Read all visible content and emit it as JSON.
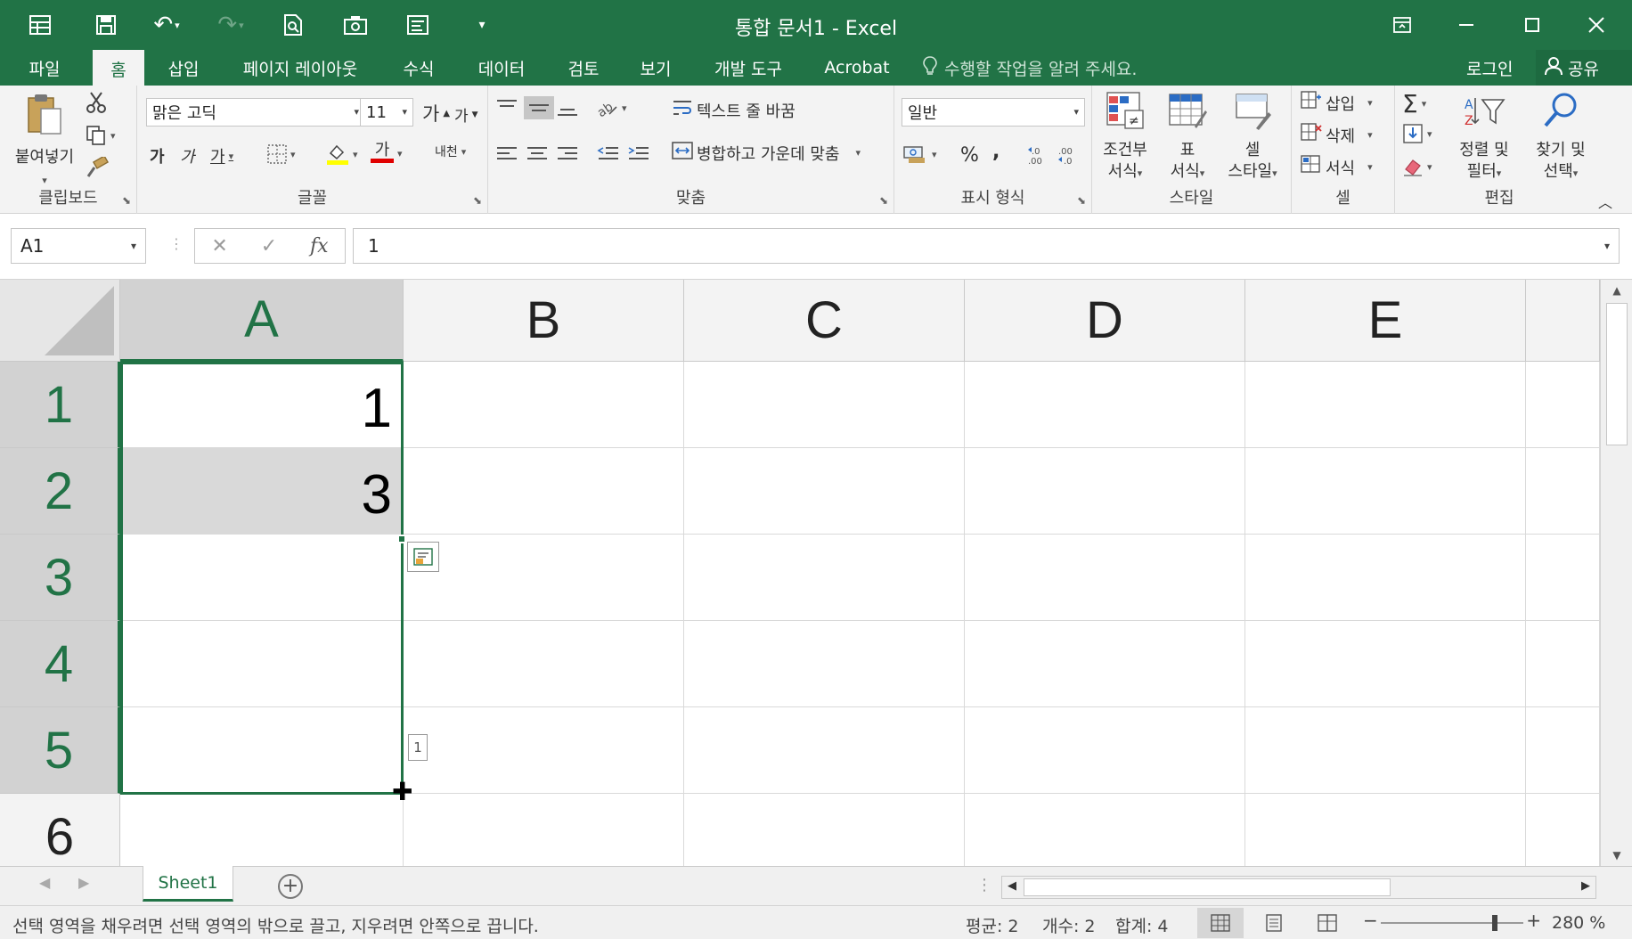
{
  "titlebar": {
    "title": "통합 문서1 - Excel",
    "quick_access": [
      "autosave-toggle-icon",
      "save-icon",
      "undo-icon",
      "redo-icon",
      "print-preview-icon",
      "screenshot-icon",
      "form-icon",
      "customize-qat-icon"
    ]
  },
  "tabs": {
    "items": [
      "파일",
      "홈",
      "삽입",
      "페이지 레이아웃",
      "수식",
      "데이터",
      "검토",
      "보기",
      "개발 도구",
      "Acrobat"
    ],
    "active": "홈",
    "tell_me": "수행할 작업을 알려 주세요.",
    "login": "로그인",
    "share": "공유"
  },
  "ribbon": {
    "clipboard": {
      "paste": "붙여넣기",
      "label": "클립보드"
    },
    "font": {
      "name": "맑은 고딕",
      "size": "11",
      "grow": "가",
      "shrink": "가",
      "bold": "가",
      "italic": "가",
      "underline": "가",
      "font_color_glyph": "가",
      "phonetic": "내천",
      "label": "글꼴"
    },
    "alignment": {
      "wrap_text": "텍스트 줄 바꿈",
      "merge_center": "병합하고 가운데 맞춤",
      "label": "맞춤"
    },
    "number": {
      "format": "일반",
      "percent": "%",
      "comma": ",",
      "label": "표시 형식"
    },
    "styles": {
      "conditional": [
        "조건부",
        "서식"
      ],
      "table": [
        "표",
        "서식"
      ],
      "cell": [
        "셀",
        "스타일"
      ],
      "label": "스타일"
    },
    "cells": {
      "insert": "삽입",
      "delete": "삭제",
      "format": "서식",
      "label": "셀"
    },
    "editing": {
      "sort": [
        "정렬 및",
        "필터"
      ],
      "find": [
        "찾기 및",
        "선택"
      ],
      "label": "편집"
    }
  },
  "formula_bar": {
    "name_box": "A1",
    "cancel": "✕",
    "enter": "✓",
    "fx": "fx",
    "value": "1"
  },
  "grid": {
    "columns": [
      "A",
      "B",
      "C",
      "D",
      "E"
    ],
    "rows": [
      "1",
      "2",
      "3",
      "4",
      "5",
      "6"
    ],
    "cells": {
      "A1": "1",
      "A2": "3"
    },
    "selected_range": "A1:A5",
    "fill_preview": "1"
  },
  "sheets": {
    "tabs": [
      "Sheet1"
    ],
    "active": "Sheet1"
  },
  "status": {
    "message": "선택 영역을 채우려면 선택 영역의 밖으로 끌고, 지우려면 안쪽으로 끕니다.",
    "average": "평균: 2",
    "count": "개수: 2",
    "sum": "합계: 4",
    "zoom": "280 %",
    "zoom_percent": 280
  },
  "colors": {
    "brand": "#217346",
    "selection": "#217346",
    "shaded_cell": "#d9d9d9"
  }
}
